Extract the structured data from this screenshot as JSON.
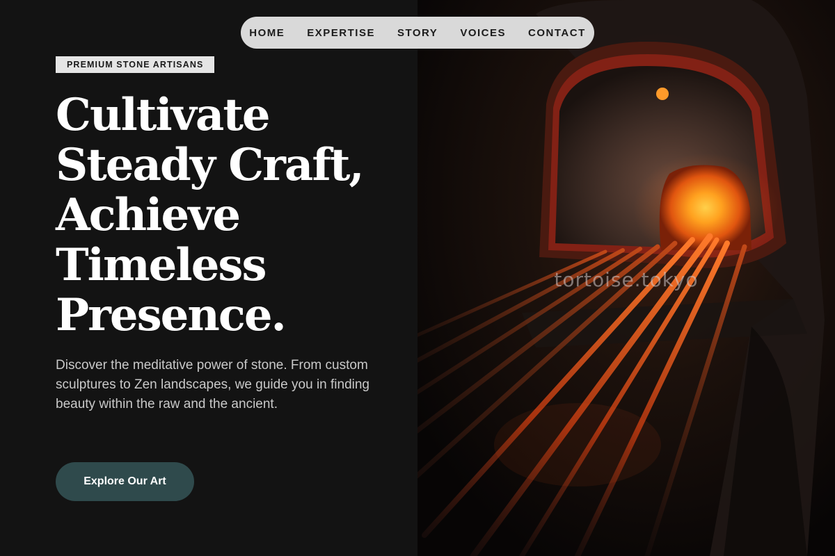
{
  "nav": {
    "items": [
      {
        "label": "HOME"
      },
      {
        "label": "EXPERTISE"
      },
      {
        "label": "STORY"
      },
      {
        "label": "VOICES"
      },
      {
        "label": "CONTACT"
      }
    ]
  },
  "hero": {
    "tag": "PREMIUM STONE ARTISANS",
    "headline_lines": [
      "Cultivate",
      "Steady Craft,",
      "Achieve",
      "Timeless",
      "Presence."
    ],
    "intro": "Discover the meditative power of stone. From custom sculptures to Zen landscapes, we guide you in finding beauty within the raw and the ancient.",
    "cta_label": "Explore Our Art",
    "image_subject": "glowing-furnace-with-rods",
    "watermark": "tortoise.tokyo"
  },
  "colors": {
    "page_background": "#131313",
    "nav_background": "#d9d9d9",
    "tag_background": "#e5e5e5",
    "cta_background": "#2f4a4c",
    "headline": "#ffffff",
    "body_text": "#c9c9c9",
    "glow": "#ff8a1c"
  }
}
